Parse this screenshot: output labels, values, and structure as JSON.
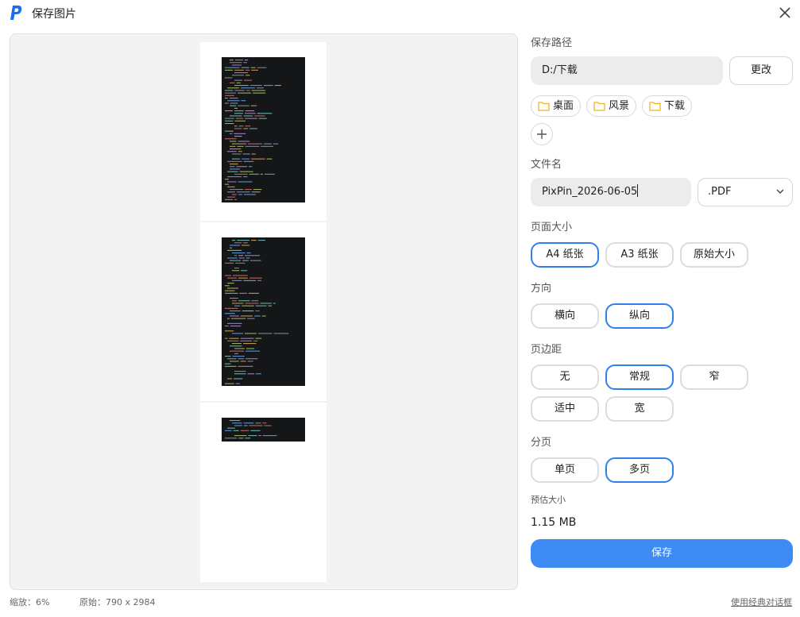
{
  "window": {
    "title": "保存图片",
    "logo_icon": "pixpin-logo-icon",
    "close_icon": "close-icon"
  },
  "preview": {
    "zoom_label": "缩放：6%",
    "original_label": "原始：790 x 2984"
  },
  "footer": {
    "classic_dialog_link": "使用经典对话框"
  },
  "save_path": {
    "label": "保存路径",
    "value": "D:/下载",
    "change_button": "更改",
    "quick_folders": [
      {
        "label": "桌面",
        "icon": "folder-icon"
      },
      {
        "label": "风景",
        "icon": "folder-icon"
      },
      {
        "label": "下载",
        "icon": "folder-icon"
      }
    ],
    "add_folder_icon": "plus-icon"
  },
  "file_name": {
    "label": "文件名",
    "value": "PixPin_2026-06-05",
    "format_selected": ".PDF",
    "format_icon": "chevron-down-icon"
  },
  "page_size": {
    "label": "页面大小",
    "options": [
      "A4 纸张",
      "A3 纸张",
      "原始大小"
    ],
    "selected": "A4 纸张"
  },
  "orientation": {
    "label": "方向",
    "options": [
      "横向",
      "纵向"
    ],
    "selected": "纵向"
  },
  "margin": {
    "label": "页边距",
    "options": [
      "无",
      "常规",
      "窄",
      "适中",
      "宽"
    ],
    "selected": "常规"
  },
  "pagination": {
    "label": "分页",
    "options": [
      "单页",
      "多页"
    ],
    "selected": "多页"
  },
  "estimated_size": {
    "label": "预估大小",
    "value": "1.15 MB"
  },
  "save_button": "保存",
  "colors": {
    "accent": "#3d8bf3",
    "selected_border": "#2f80ed",
    "folder_icon": "#f0b429",
    "logo": "#1a6cf5"
  }
}
